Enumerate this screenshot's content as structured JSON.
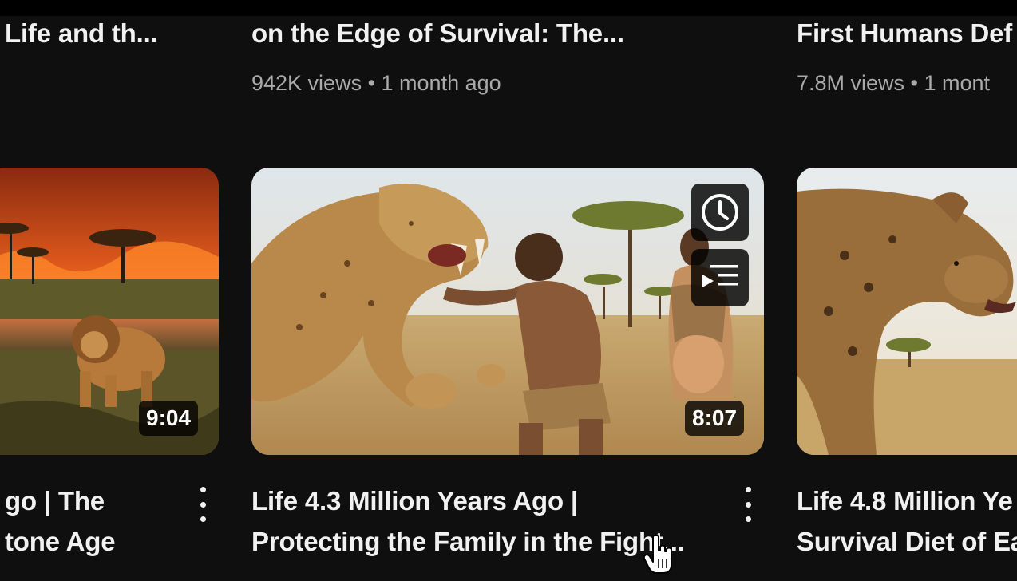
{
  "top_row": {
    "left_title": "Life and th...",
    "center_title": "on the Edge of Survival: The...",
    "center_meta": "942K views • 1 month ago",
    "right_title": "First Humans Def",
    "right_meta": "7.8M views • 1 mont"
  },
  "videos": [
    {
      "duration": "9:04",
      "title_line1": "go | The",
      "title_line2": "tone Age"
    },
    {
      "duration": "8:07",
      "title_line1": "Life 4.3 Million Years Ago |",
      "title_line2": "Protecting the Family in the Fight...",
      "hover_buttons": [
        "watch-later",
        "add-to-queue"
      ]
    },
    {
      "title_line1": "Life 4.8 Million Ye",
      "title_line2": "Survival Diet of Ea"
    }
  ],
  "icons": {
    "watch_later": "clock-icon",
    "add_to_queue": "add-to-queue-icon",
    "more_actions": "three-dot-menu-icon",
    "cursor": "hand-pointer-icon"
  },
  "colors": {
    "background": "#0f0f0f",
    "title_text": "#f1f1f1",
    "meta_text": "#aaaaaa",
    "overlay": "#000000"
  }
}
